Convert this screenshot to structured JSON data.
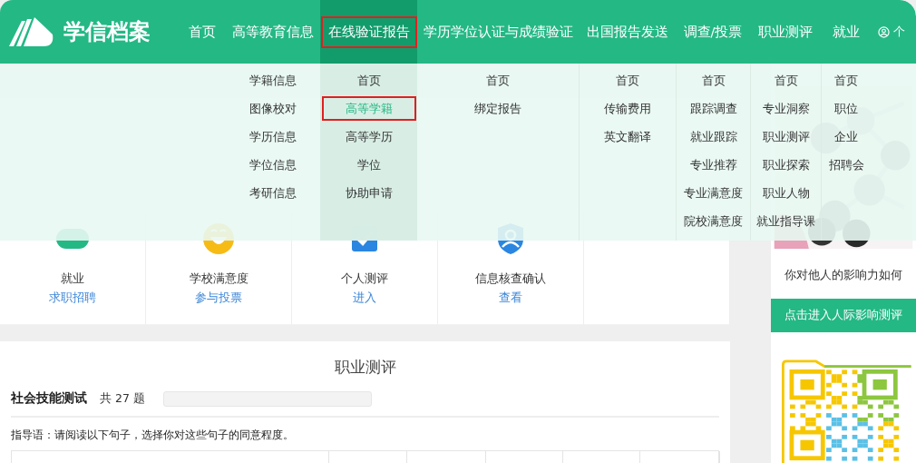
{
  "nav": {
    "logo": "学信档案",
    "user": "个",
    "items": [
      {
        "label": "首页",
        "selected": false,
        "highlighted": false
      },
      {
        "label": "高等教育信息",
        "selected": false,
        "highlighted": false,
        "menu": [
          {
            "label": "学籍信息",
            "selected": false,
            "highlighted": false
          },
          {
            "label": "图像校对",
            "selected": false,
            "highlighted": false
          },
          {
            "label": "学历信息",
            "selected": false,
            "highlighted": false
          },
          {
            "label": "学位信息",
            "selected": false,
            "highlighted": false
          },
          {
            "label": "考研信息",
            "selected": false,
            "highlighted": false
          }
        ]
      },
      {
        "label": "在线验证报告",
        "selected": true,
        "highlighted": true,
        "menu": [
          {
            "label": "首页",
            "selected": false,
            "highlighted": false
          },
          {
            "label": "高等学籍",
            "selected": true,
            "highlighted": true
          },
          {
            "label": "高等学历",
            "selected": false,
            "highlighted": false
          },
          {
            "label": "学位",
            "selected": false,
            "highlighted": false
          },
          {
            "label": "协助申请",
            "selected": false,
            "highlighted": false
          }
        ]
      },
      {
        "label": "学历学位认证与成绩验证",
        "selected": false,
        "highlighted": false,
        "menu": [
          {
            "label": "首页",
            "selected": false,
            "highlighted": false
          },
          {
            "label": "绑定报告",
            "selected": false,
            "highlighted": false
          }
        ]
      },
      {
        "label": "出国报告发送",
        "selected": false,
        "highlighted": false,
        "menu": [
          {
            "label": "首页",
            "selected": false,
            "highlighted": false
          },
          {
            "label": "传输费用",
            "selected": false,
            "highlighted": false
          },
          {
            "label": "英文翻译",
            "selected": false,
            "highlighted": false
          }
        ]
      },
      {
        "label": "调查/投票",
        "selected": false,
        "highlighted": false,
        "menu": [
          {
            "label": "首页",
            "selected": false,
            "highlighted": false
          },
          {
            "label": "跟踪调查",
            "selected": false,
            "highlighted": false
          },
          {
            "label": "就业跟踪",
            "selected": false,
            "highlighted": false
          },
          {
            "label": "专业推荐",
            "selected": false,
            "highlighted": false
          },
          {
            "label": "专业满意度",
            "selected": false,
            "highlighted": false
          },
          {
            "label": "院校满意度",
            "selected": false,
            "highlighted": false
          }
        ]
      },
      {
        "label": "职业测评",
        "selected": false,
        "highlighted": false,
        "menu": [
          {
            "label": "首页",
            "selected": false,
            "highlighted": false
          },
          {
            "label": "专业洞察",
            "selected": false,
            "highlighted": false
          },
          {
            "label": "职业测评",
            "selected": false,
            "highlighted": false
          },
          {
            "label": "职业探索",
            "selected": false,
            "highlighted": false
          },
          {
            "label": "职业人物",
            "selected": false,
            "highlighted": false
          },
          {
            "label": "就业指导课",
            "selected": false,
            "highlighted": false
          }
        ]
      },
      {
        "label": "就业",
        "selected": false,
        "highlighted": false,
        "menu": [
          {
            "label": "首页",
            "selected": false,
            "highlighted": false
          },
          {
            "label": "职位",
            "selected": false,
            "highlighted": false
          },
          {
            "label": "企业",
            "selected": false,
            "highlighted": false
          },
          {
            "label": "招聘会",
            "selected": false,
            "highlighted": false
          }
        ]
      }
    ]
  },
  "cards": [
    {
      "kind": "service",
      "title": "就业",
      "links": [
        "求职招聘"
      ]
    },
    {
      "kind": "service",
      "title": "学校满意度",
      "links": [
        "参与投票"
      ]
    },
    {
      "kind": "service",
      "title": "个人测评",
      "links": [
        "进入"
      ]
    },
    {
      "kind": "service",
      "title": "信息核查确认",
      "links": [
        "查看"
      ]
    },
    {
      "kind": "blank"
    }
  ],
  "test": {
    "title": "职业测评",
    "name": "社会技能测试",
    "count": "共 27 题",
    "progress": {
      "level": 0
    },
    "instruction": "指导语：请阅读以下句子，选择你对这些句子的同意程度。"
  },
  "sidebar": {
    "caption": "你对他人的影响力如何",
    "button": "点击进入人际影响测评"
  }
}
